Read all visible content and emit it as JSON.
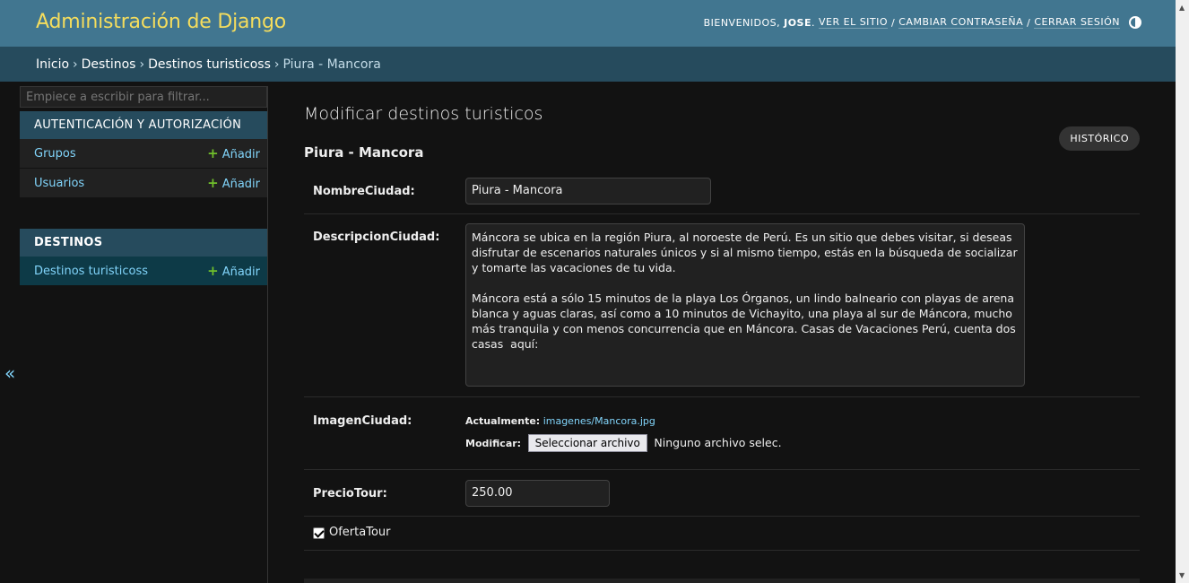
{
  "header": {
    "branding": "Administración de Django",
    "welcome": "Bienvenidos,",
    "username": "JOSE",
    "view_site": "Ver el sitio",
    "change_password": "Cambiar contraseña",
    "logout": "Cerrar sesión",
    "theme_icon": "theme-toggle-icon"
  },
  "breadcrumbs": {
    "items": [
      "Inicio",
      "Destinos",
      "Destinos turisticoss",
      "Piura - Mancora"
    ],
    "separator": "›"
  },
  "sidebar": {
    "filter_placeholder": "Empiece a escribir para filtrar...",
    "apps": [
      {
        "caption": "Autenticación y autorización",
        "models": [
          {
            "name": "Grupos",
            "add": "Añadir"
          },
          {
            "name": "Usuarios",
            "add": "Añadir"
          }
        ]
      },
      {
        "caption": "DESTINOS",
        "models": [
          {
            "name": "Destinos turisticoss",
            "add": "Añadir"
          }
        ]
      }
    ],
    "toggle": "«"
  },
  "main": {
    "title": "Modificar destinos turisticos",
    "object_title": "Piura - Mancora",
    "history_button": "Histórico",
    "fields": {
      "nombre": {
        "label": "NombreCiudad:",
        "value": "Piura - Mancora"
      },
      "descripcion": {
        "label": "DescripcionCiudad:",
        "value": "Máncora se ubica en la región Piura, al noroeste de Perú. Es un sitio que debes visitar, si deseas disfrutar de escenarios naturales únicos y si al mismo tiempo, estás en la búsqueda de socializar y tomarte las vacaciones de tu vida.\n\nMáncora está a sólo 15 minutos de la playa Los Órganos, un lindo balneario con playas de arena blanca y aguas claras, así como a 10 minutos de Vichayito, una playa al sur de Máncora, mucho más tranquila y con menos concurrencia que en Máncora. Casas de Vacaciones Perú, cuenta dos casas  aquí:"
      },
      "imagen": {
        "label": "ImagenCiudad:",
        "current_label": "Actualmente:",
        "current_value": "imagenes/Mancora.jpg",
        "change_label": "Modificar:",
        "button": "Seleccionar archivo",
        "no_file": "Ninguno archivo selec."
      },
      "precio": {
        "label": "PrecioTour:",
        "value": "250.00"
      },
      "oferta": {
        "label": "OfertaTour",
        "checked": true
      }
    }
  },
  "colors": {
    "header_bg": "#417690",
    "breadcrumb_bg": "#264b5d",
    "branding": "#f5dd5d",
    "link": "#81d4fa",
    "add_icon": "#70bf2b",
    "body_bg": "#121212"
  }
}
